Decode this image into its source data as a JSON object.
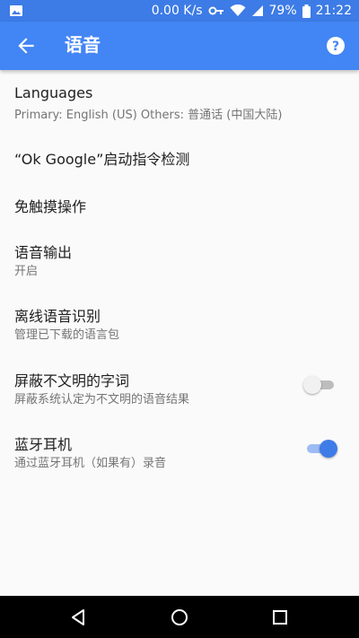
{
  "status_bar": {
    "network_speed": "0.00 K/s",
    "battery_percent": "79%",
    "time": "21:22",
    "icons": [
      "image-icon",
      "key-icon",
      "wifi-icon",
      "signal-icon",
      "battery-icon"
    ]
  },
  "app_bar": {
    "title": "语音",
    "back_icon": "arrow-back-icon",
    "help_icon": "help-icon",
    "color": "#4285f4"
  },
  "settings": {
    "languages": {
      "title": "Languages",
      "summary": "Primary: English (US) Others: 普通话 (中国大陆)"
    },
    "ok_google": {
      "title": "“Ok Google”启动指令检测"
    },
    "hands_free": {
      "title": "免触摸操作"
    },
    "speech_output": {
      "title": "语音输出",
      "summary": "开启"
    },
    "offline_recognition": {
      "title": "离线语音识别",
      "summary": "管理已下载的语言包"
    },
    "block_offensive": {
      "title": "屏蔽不文明的字词",
      "summary": "屏蔽系统认定为不文明的语音结果",
      "enabled": false
    },
    "bluetooth_headset": {
      "title": "蓝牙耳机",
      "summary": "通过蓝牙耳机（如果有）录音",
      "enabled": true
    }
  },
  "nav_bar": {
    "icons": [
      "back-triangle-icon",
      "home-circle-icon",
      "recents-square-icon"
    ]
  }
}
